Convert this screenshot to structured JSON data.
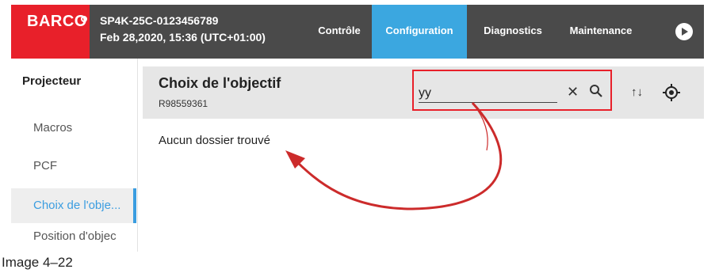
{
  "brand": {
    "logo_text": "BARCO"
  },
  "device": {
    "id": "SP4K-25C-0123456789",
    "datetime": "Feb 28,2020, 15:36 (UTC+01:00)"
  },
  "nav": {
    "tabs": [
      {
        "label": "Contrôle",
        "active": false
      },
      {
        "label": "Configuration",
        "active": true
      },
      {
        "label": "Diagnostics",
        "active": false
      },
      {
        "label": "Maintenance",
        "active": false
      }
    ],
    "more_icon": "play-circle-icon"
  },
  "sidebar": {
    "heading": "Projecteur",
    "items": [
      {
        "label": "Macros",
        "active": false
      },
      {
        "label": "PCF",
        "active": false
      },
      {
        "label": "Choix de l'obje...",
        "active": true
      },
      {
        "label": "Position d'objec",
        "active": false
      }
    ]
  },
  "main": {
    "title": "Choix de l'objectif",
    "subtitle": "R98559361",
    "search": {
      "value": "yy",
      "clear_icon": "close-icon",
      "search_icon": "search-icon"
    },
    "toolbar": {
      "sort_icon": "sort-icon",
      "locate_icon": "target-icon"
    },
    "empty_message": "Aucun dossier trouvé"
  },
  "colors": {
    "brand_red": "#e8202a",
    "topbar": "#4a4a4a",
    "active_tab": "#3ba7e0",
    "active_side": "#3b9de0",
    "annotation_arrow": "#cc2b2b"
  },
  "caption": "Image  4–22"
}
